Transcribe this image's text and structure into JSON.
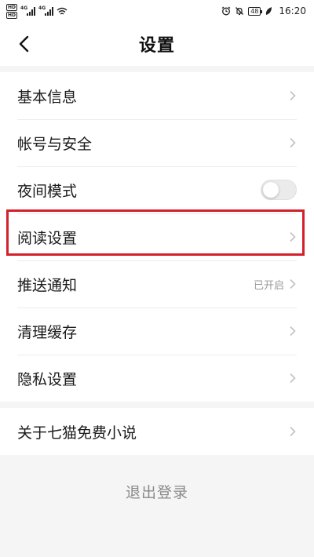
{
  "status_bar": {
    "sim1": "HD",
    "sim2": "HD",
    "net1": "4G",
    "net2": "4G",
    "battery": "48",
    "time": "16:20"
  },
  "header": {
    "title": "设置"
  },
  "settings": {
    "items": [
      {
        "label": "基本信息"
      },
      {
        "label": "帐号与安全"
      },
      {
        "label": "夜间模式",
        "toggle_on": false
      },
      {
        "label": "阅读设置"
      },
      {
        "label": "推送通知",
        "value": "已开启"
      },
      {
        "label": "清理缓存"
      },
      {
        "label": "隐私设置"
      }
    ]
  },
  "about": {
    "label": "关于七猫免费小说"
  },
  "logout": {
    "label": "退出登录"
  },
  "colors": {
    "highlight": "#d3202a",
    "background": "#f5f5f5"
  }
}
